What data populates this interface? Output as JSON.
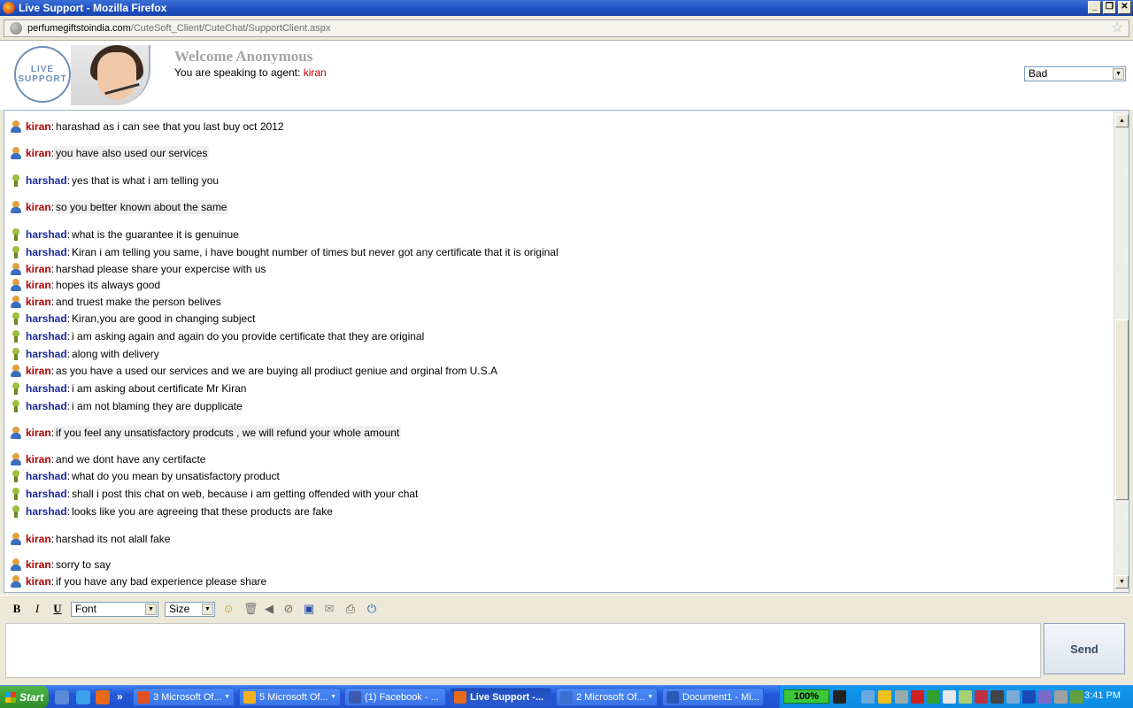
{
  "window": {
    "title": "Live Support - Mozilla Firefox",
    "minimize": "_",
    "maximize": "❐",
    "close": "✕"
  },
  "urlbar": {
    "domain": "perfumegiftstoindia.com",
    "path": "/CuteSoft_Client/CuteChat/SupportClient.aspx"
  },
  "header": {
    "logo_line1": "LIVE",
    "logo_line2": "SUPPORT",
    "welcome": "Welcome Anonymous",
    "speaking_prefix": "You are speaking to agent:",
    "agent_name": "kiran",
    "rating_value": "Bad"
  },
  "messages": [
    {
      "who": "agent",
      "name": "kiran",
      "text": "harashad as i can see that you last buy oct 2012",
      "hl": false
    },
    {
      "who": "agent",
      "name": "kiran",
      "text": "you have also used our services",
      "hl": true
    },
    {
      "who": "user",
      "name": "harshad",
      "text": "yes that is what i am telling you",
      "hl": false
    },
    {
      "who": "agent",
      "name": "kiran",
      "text": "so you better known about the same",
      "hl": true
    },
    {
      "who": "user",
      "name": "harshad",
      "text": "what is the guarantee it is genuinue",
      "hl": false
    },
    {
      "who": "user",
      "name": "harshad",
      "text": "Kiran i am telling you same, i have bought number of times but never got any certificate that it is original",
      "hl": false
    },
    {
      "who": "agent",
      "name": "kiran",
      "text": "harshad please share your expercise with us",
      "hl": false
    },
    {
      "who": "agent",
      "name": "kiran",
      "text": "hopes its always good",
      "hl": false
    },
    {
      "who": "agent",
      "name": "kiran",
      "text": "and truest make the person belives",
      "hl": false
    },
    {
      "who": "user",
      "name": "harshad",
      "text": "Kiran,you are good in changing subject",
      "hl": false
    },
    {
      "who": "user",
      "name": "harshad",
      "text": "i am asking again and again do you provide certificate that they are original",
      "hl": false
    },
    {
      "who": "user",
      "name": "harshad",
      "text": "along with delivery",
      "hl": false
    },
    {
      "who": "agent",
      "name": "kiran",
      "text": "as you have a used our services and we are buying all prodiuct geniue and orginal from U.S.A",
      "hl": false
    },
    {
      "who": "user",
      "name": "harshad",
      "text": "i am asking about certificate Mr Kiran",
      "hl": false
    },
    {
      "who": "user",
      "name": "harshad",
      "text": "i am not blaming they are dupplicate",
      "hl": false
    },
    {
      "who": "agent",
      "name": "kiran",
      "text": "if you feel any unsatisfactory prodcuts , we will refund your whole amount",
      "hl": true
    },
    {
      "who": "agent",
      "name": "kiran",
      "text": "and we dont have any certifacte",
      "hl": false
    },
    {
      "who": "user",
      "name": "harshad",
      "text": "what do you mean by unsatisfactory product",
      "hl": false
    },
    {
      "who": "user",
      "name": "harshad",
      "text": "shall i post this chat on web, because i am getting offended with your chat",
      "hl": false
    },
    {
      "who": "user",
      "name": "harshad",
      "text": "looks like you are agreeing that these products are fake",
      "hl": false
    },
    {
      "who": "agent",
      "name": "kiran",
      "text": "harshad its not alall fake",
      "hl": false
    },
    {
      "who": "agent",
      "name": "kiran",
      "text": "sorry to say",
      "hl": false
    },
    {
      "who": "agent",
      "name": "kiran",
      "text": "if you have any bad experience please share",
      "hl": false
    }
  ],
  "toolbar": {
    "bold": "B",
    "italic": "I",
    "underline": "U",
    "font_label": "Font",
    "size_label": "Size",
    "icons": [
      "emoticon-icon",
      "trash-icon",
      "speaker-icon",
      "attach-icon",
      "save-icon",
      "email-icon",
      "print-icon",
      "power-icon"
    ]
  },
  "input": {
    "value": "",
    "send_label": "Send"
  },
  "taskbar": {
    "start_label": "Start",
    "tasks": [
      {
        "label": "3 Microsoft Of...",
        "arrow": true
      },
      {
        "label": "5 Microsoft Of...",
        "arrow": true
      },
      {
        "label": "(1) Facebook - ...",
        "arrow": false
      },
      {
        "label": "Live Support -...",
        "arrow": false,
        "active": true
      },
      {
        "label": "2 Microsoft Of...",
        "arrow": true
      },
      {
        "label": "Document1 - Mi...",
        "arrow": false
      }
    ],
    "battery": "100%",
    "clock": "3:41 PM"
  },
  "colors": {
    "agent_name": "#b00000",
    "user_name": "#1a2a9a",
    "titlebar": "#1d4fbf",
    "taskbar": "#2357d8"
  }
}
